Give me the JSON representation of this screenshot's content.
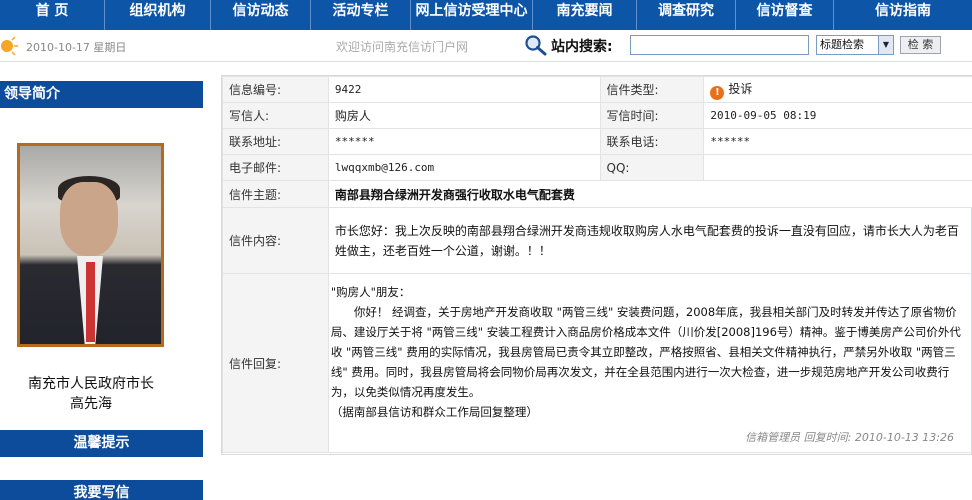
{
  "nav": {
    "items": [
      "首 页",
      "组织机构",
      "信访动态",
      "活动专栏",
      "网上信访受理中心",
      "南充要闻",
      "调查研究",
      "信访督查",
      "信访指南"
    ]
  },
  "subbar": {
    "date": "2010-10-17  星期日",
    "welcome": "欢迎访问南充信访门户网",
    "search_label": "站内搜索:",
    "search_value": "",
    "search_select": "标题检索",
    "search_button": "检 索"
  },
  "sidebar": {
    "leader_heading": "领导简介",
    "leader_title": "南充市人民政府市长",
    "leader_name": "高先海",
    "tips_heading": "温馨提示",
    "write_heading": "我要写信"
  },
  "letter": {
    "id_label": "信息编号:",
    "id_value": "9422",
    "type_label": "信件类型:",
    "type_value": "投诉",
    "writer_label": "写信人:",
    "writer_value": "购房人",
    "time_label": "写信时间:",
    "time_value": "2010-09-05 08:19",
    "address_label": "联系地址:",
    "address_value": "******",
    "phone_label": "联系电话:",
    "phone_value": "******",
    "email_label": "电子邮件:",
    "email_value": "lwqqxmb@126.com",
    "qq_label": "QQ:",
    "qq_value": "",
    "subject_label": "信件主题:",
    "subject_value": "南部县翔合绿洲开发商强行收取水电气配套费",
    "content_label": "信件内容:",
    "content_value": "市长您好：我上次反映的南部县翔合绿洲开发商违规收取购房人水电气配套费的投诉一直没有回应，请市长大人为老百姓做主，还老百姓一个公道，谢谢。！！",
    "reply_label": "信件回复:",
    "reply_greeting": "\"购房人\"朋友：",
    "reply_body": "你好！  经调查，关于房地产开发商收取 \"两管三线\" 安装费问题，2008年底，我县相关部门及时转发并传达了原省物价局、建设厅关于将 \"两管三线\" 安装工程费计入商品房价格成本文件（川价发[2008]196号）精神。鉴于博美房产公司价外代收 \"两管三线\" 费用的实际情况，我县房管局已责令其立即整改，严格按照省、县相关文件精神执行，严禁另外收取 \"两管三线\" 费用。同时，我县房管局将会同物价局再次发文，并在全县范围内进行一次大检查，进一步规范房地产开发公司收费行为，以免类似情况再度发生。",
    "reply_source": "（据南部县信访和群众工作局回复整理）",
    "reply_meta": "信箱管理员  回复时间: 2010-10-13 13:26"
  },
  "colors": {
    "nav_blue": "#0d55a6",
    "sidebar_blue": "#0d4c9a",
    "warning_orange": "#e8701a"
  }
}
